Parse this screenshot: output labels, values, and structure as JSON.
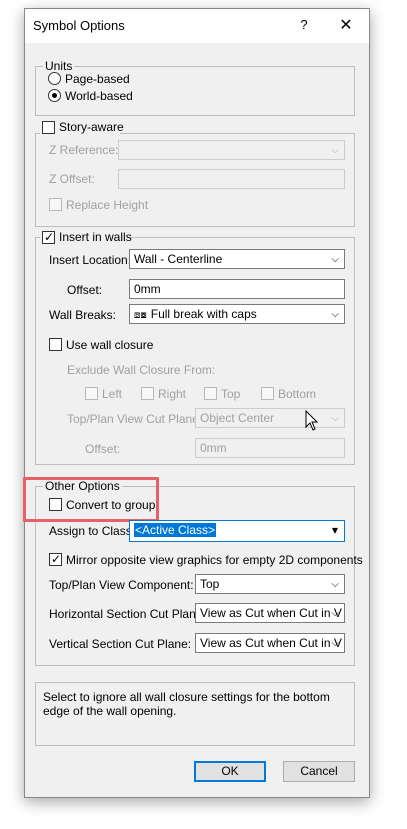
{
  "window": {
    "title": "Symbol Options",
    "help_label": "?",
    "close_label": "✕"
  },
  "units": {
    "legend": "Units",
    "options": [
      "Page-based",
      "World-based"
    ],
    "selected": "World-based"
  },
  "story_aware": {
    "label": "Story-aware",
    "checked": false,
    "z_reference_label": "Z Reference:",
    "z_reference_value": "",
    "z_offset_label": "Z Offset:",
    "z_offset_value": "",
    "replace_height_label": "Replace Height"
  },
  "insert_in_walls": {
    "label": "Insert in walls",
    "checked": true,
    "insert_location_label": "Insert Location:",
    "insert_location_value": "Wall - Centerline",
    "offset_label": "Offset:",
    "offset_value": "0mm",
    "wall_breaks_label": "Wall Breaks:",
    "wall_breaks_icon": "full-break-caps-icon",
    "wall_breaks_value": "Full break with caps",
    "use_wall_closure_label": "Use wall closure",
    "exclude_label": "Exclude Wall Closure From:",
    "sides": [
      "Left",
      "Right",
      "Top",
      "Bottom"
    ],
    "cut_plane_label": "Top/Plan View Cut Plane:",
    "cut_plane_value": "Object Center",
    "offset2_label": "Offset:",
    "offset2_value": "0mm"
  },
  "other_options": {
    "legend": "Other Options",
    "convert_to_group_label": "Convert to group",
    "assign_class_label": "Assign to Class:",
    "assign_class_value": "<Active Class>",
    "mirror_label": "Mirror opposite view graphics for empty 2D components",
    "top_plan_component_label": "Top/Plan View Component:",
    "top_plan_component_value": "Top",
    "horizontal_cut_label": "Horizontal Section Cut Plane:",
    "horizontal_cut_value": "View as Cut when Cut in V",
    "vertical_cut_label": "Vertical Section Cut Plane:",
    "vertical_cut_value": "View as Cut when Cut in V"
  },
  "help_text": "Select to ignore all wall closure settings for the bottom edge of the wall opening.",
  "buttons": {
    "ok": "OK",
    "cancel": "Cancel"
  },
  "colors": {
    "highlight": "#e8606a",
    "selection": "#0078d7"
  }
}
